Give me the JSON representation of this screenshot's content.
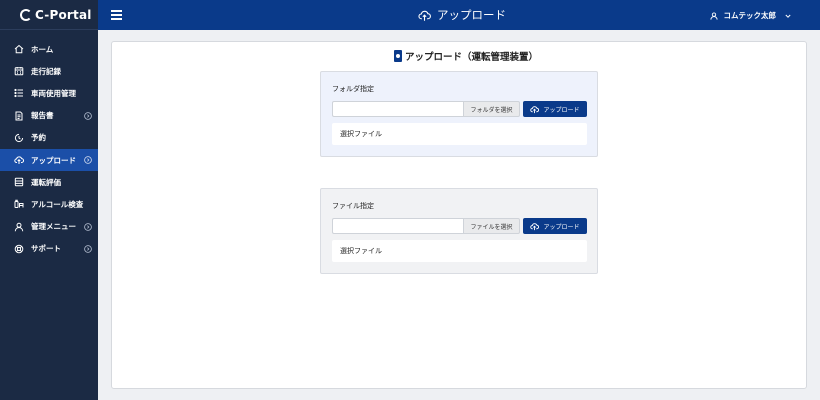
{
  "app": {
    "logo_text": "C-Portal"
  },
  "sidebar": {
    "items": [
      {
        "label": "ホーム",
        "icon": "home-icon",
        "chevron": false,
        "active": false
      },
      {
        "label": "走行記録",
        "icon": "calendar-icon",
        "chevron": false,
        "active": false
      },
      {
        "label": "車両使用管理",
        "icon": "list-icon",
        "chevron": false,
        "active": false
      },
      {
        "label": "報告書",
        "icon": "report-icon",
        "chevron": true,
        "active": false
      },
      {
        "label": "予約",
        "icon": "reservation-icon",
        "chevron": false,
        "active": false
      },
      {
        "label": "アップロード",
        "icon": "cloud-upload-icon",
        "chevron": true,
        "active": true
      },
      {
        "label": "運転評価",
        "icon": "evaluation-icon",
        "chevron": false,
        "active": false
      },
      {
        "label": "アルコール検査",
        "icon": "alcohol-check-icon",
        "chevron": false,
        "active": false
      },
      {
        "label": "管理メニュー",
        "icon": "admin-icon",
        "chevron": true,
        "active": false
      },
      {
        "label": "サポート",
        "icon": "support-icon",
        "chevron": true,
        "active": false
      }
    ]
  },
  "header": {
    "title": "アップロード",
    "title_icon": "cloud-upload-icon",
    "user_name": "コムテック太郎",
    "user_icon": "user-icon"
  },
  "main": {
    "page_title": "アップロード（運転管理装置）",
    "folder_panel": {
      "label": "フォルダ指定",
      "browse_label": "フォルダを選択",
      "upload_label": "アップロード",
      "selected_label": "選択ファイル"
    },
    "file_panel": {
      "label": "ファイル指定",
      "browse_label": "ファイルを選択",
      "upload_label": "アップロード",
      "selected_label": "選択ファイル"
    }
  },
  "colors": {
    "sidebar_bg": "#1b2a44",
    "header_bg": "#0a3a8a",
    "active_item": "#1b4fa8",
    "primary_button": "#0a3a8a"
  }
}
